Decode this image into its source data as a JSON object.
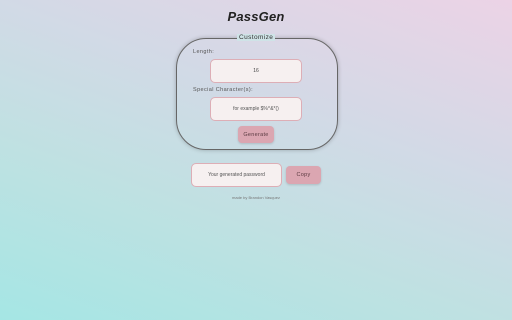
{
  "app": {
    "title": "PassGen"
  },
  "customize": {
    "legend": "Customize",
    "length_label": "Length:",
    "length_value": "16",
    "special_label": "Special Character(s):",
    "special_placeholder": "for example $%^&*()",
    "generate_label": "Generate"
  },
  "output": {
    "password_placeholder": "Your generated password",
    "copy_label": "Copy"
  },
  "footer": {
    "credit": "made by Brandon Vasquez"
  },
  "colors": {
    "button": "#dba6b1",
    "input_bg": "#f6f0f0",
    "input_border": "#ddaeb6"
  }
}
